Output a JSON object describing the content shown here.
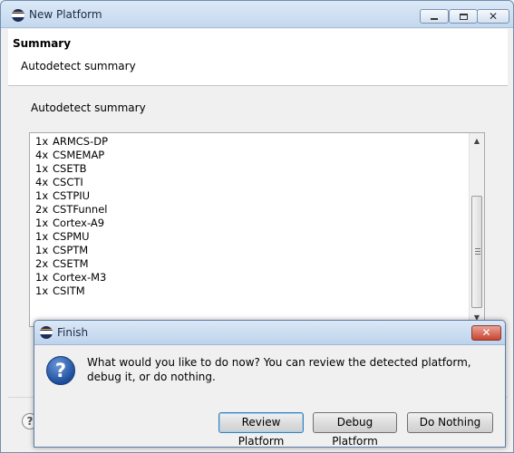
{
  "window": {
    "title": "New Platform",
    "icon": "eclipse-icon"
  },
  "wizard": {
    "title": "Summary",
    "description": "Autodetect summary",
    "content_label": "Autodetect summary",
    "summary_items": [
      {
        "count": "1x",
        "name": "ARMCS-DP"
      },
      {
        "count": "4x",
        "name": "CSMEMAP"
      },
      {
        "count": "1x",
        "name": "CSETB"
      },
      {
        "count": "4x",
        "name": "CSCTI"
      },
      {
        "count": "1x",
        "name": "CSTPIU"
      },
      {
        "count": "2x",
        "name": "CSTFunnel"
      },
      {
        "count": "1x",
        "name": "Cortex-A9"
      },
      {
        "count": "1x",
        "name": "CSPMU"
      },
      {
        "count": "1x",
        "name": "CSPTM"
      },
      {
        "count": "2x",
        "name": "CSETM"
      },
      {
        "count": "1x",
        "name": "Cortex-M3"
      },
      {
        "count": "1x",
        "name": "CSITM"
      }
    ],
    "help_glyph": "?"
  },
  "dialog": {
    "title": "Finish",
    "icon": "question-icon",
    "message": "What would you like to do now? You can review the detected platform, debug it, or do nothing.",
    "buttons": {
      "review": "Review Platform",
      "debug": "Debug Platform",
      "nothing": "Do Nothing"
    }
  }
}
